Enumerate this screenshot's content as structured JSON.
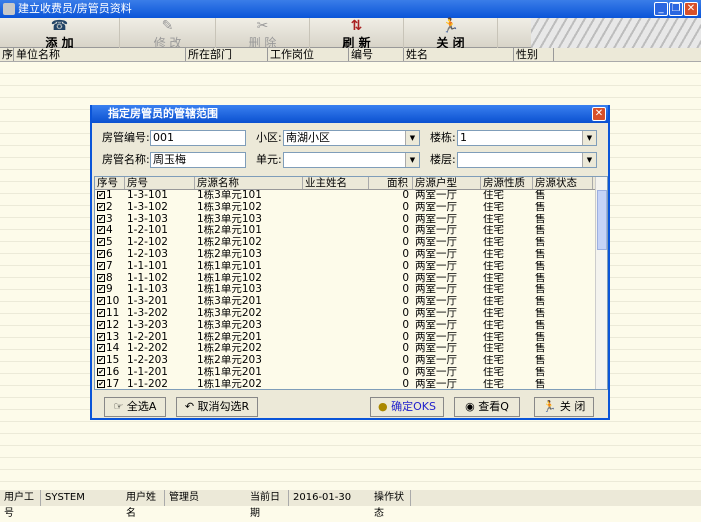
{
  "window": {
    "title": "建立收费员/房管员资料"
  },
  "toolbar": [
    {
      "label": "添 加",
      "icon": "phone-icon"
    },
    {
      "label": "修 改",
      "icon": "edit-icon"
    },
    {
      "label": "删 除",
      "icon": "scissors-icon"
    },
    {
      "label": "刷 新",
      "icon": "refresh-icon"
    },
    {
      "label": "关 闭",
      "icon": "running-man-icon"
    }
  ],
  "grid_headers": [
    "序号",
    "单位名称",
    "所在部门",
    "工作岗位",
    "编号",
    "姓名",
    "性别"
  ],
  "dialog": {
    "title": "指定房管员的管辖范围",
    "fields": {
      "code_label": "房管编号:",
      "code": "001",
      "name_label": "房管名称:",
      "name": "周玉梅",
      "area_label": "小区:",
      "area": "南湖小区",
      "unit_label": "单元:",
      "unit": "",
      "building_label": "楼栋:",
      "building": "1",
      "floor_label": "楼层:",
      "floor": ""
    },
    "columns": [
      "序号",
      "房号",
      "房源名称",
      "业主姓名",
      "面积",
      "房源户型",
      "房源性质",
      "房源状态"
    ],
    "rows": [
      [
        "1",
        "1-3-101",
        "1栋3单元101",
        "",
        "0",
        "两室一厅",
        "住宅",
        "售"
      ],
      [
        "2",
        "1-3-102",
        "1栋3单元102",
        "",
        "0",
        "两室一厅",
        "住宅",
        "售"
      ],
      [
        "3",
        "1-3-103",
        "1栋3单元103",
        "",
        "0",
        "两室一厅",
        "住宅",
        "售"
      ],
      [
        "4",
        "1-2-101",
        "1栋2单元101",
        "",
        "0",
        "两室一厅",
        "住宅",
        "售"
      ],
      [
        "5",
        "1-2-102",
        "1栋2单元102",
        "",
        "0",
        "两室一厅",
        "住宅",
        "售"
      ],
      [
        "6",
        "1-2-103",
        "1栋2单元103",
        "",
        "0",
        "两室一厅",
        "住宅",
        "售"
      ],
      [
        "7",
        "1-1-101",
        "1栋1单元101",
        "",
        "0",
        "两室一厅",
        "住宅",
        "售"
      ],
      [
        "8",
        "1-1-102",
        "1栋1单元102",
        "",
        "0",
        "两室一厅",
        "住宅",
        "售"
      ],
      [
        "9",
        "1-1-103",
        "1栋1单元103",
        "",
        "0",
        "两室一厅",
        "住宅",
        "售"
      ],
      [
        "10",
        "1-3-201",
        "1栋3单元201",
        "",
        "0",
        "两室一厅",
        "住宅",
        "售"
      ],
      [
        "11",
        "1-3-202",
        "1栋3单元202",
        "",
        "0",
        "两室一厅",
        "住宅",
        "售"
      ],
      [
        "12",
        "1-3-203",
        "1栋3单元203",
        "",
        "0",
        "两室一厅",
        "住宅",
        "售"
      ],
      [
        "13",
        "1-2-201",
        "1栋2单元201",
        "",
        "0",
        "两室一厅",
        "住宅",
        "售"
      ],
      [
        "14",
        "1-2-202",
        "1栋2单元202",
        "",
        "0",
        "两室一厅",
        "住宅",
        "售"
      ],
      [
        "15",
        "1-2-203",
        "1栋2单元203",
        "",
        "0",
        "两室一厅",
        "住宅",
        "售"
      ],
      [
        "16",
        "1-1-201",
        "1栋1单元201",
        "",
        "0",
        "两室一厅",
        "住宅",
        "售"
      ],
      [
        "17",
        "1-1-202",
        "1栋1单元202",
        "",
        "0",
        "两室一厅",
        "住宅",
        "售"
      ]
    ],
    "buttons": {
      "select_all": "全选A",
      "deselect": "取消勾选R",
      "ok": "确定OKS",
      "view": "查看Q",
      "close": "关 闭"
    }
  },
  "status": {
    "user_id_label": "用户工号",
    "user_id": "SYSTEM",
    "user_name_label": "用户姓名",
    "user_name": "管理员",
    "date_label": "当前日期",
    "date": "2016-01-30",
    "op_label": "操作状态",
    "op": ""
  }
}
